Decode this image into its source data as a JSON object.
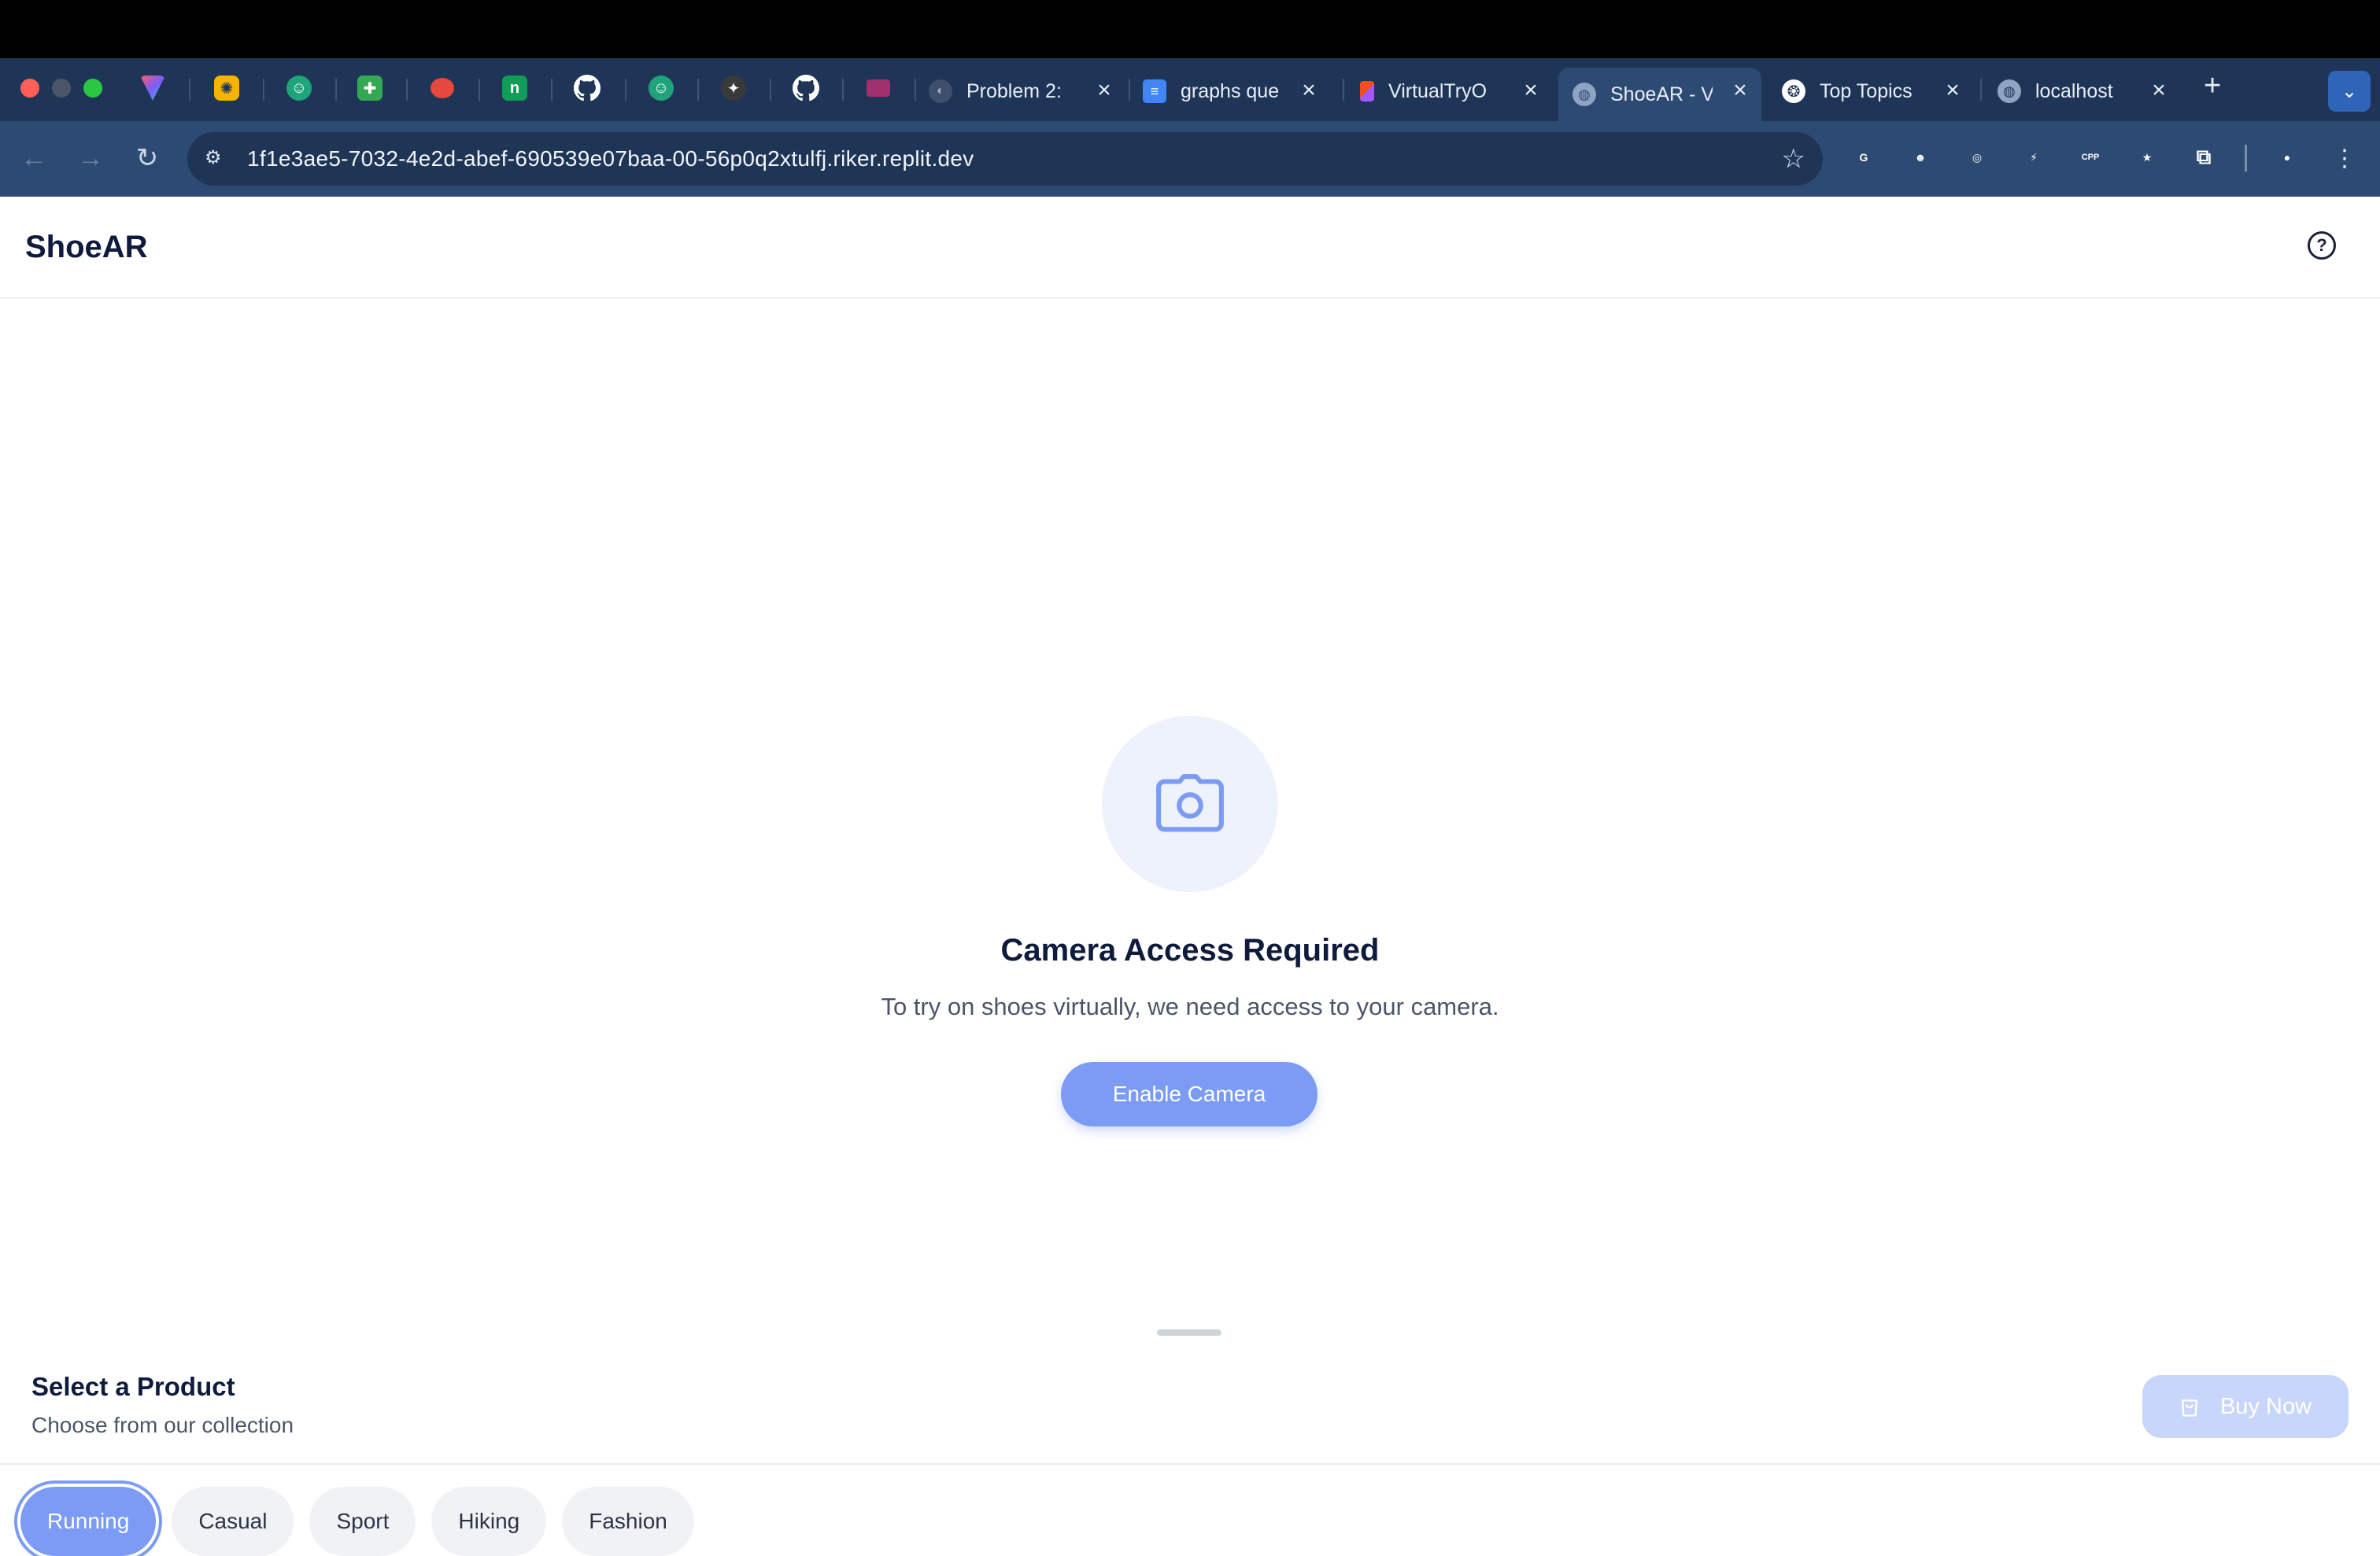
{
  "browser": {
    "pinned_tabs": [
      {
        "icon": "prism-icon",
        "color": "#7c5cff"
      },
      {
        "icon": "compass-icon",
        "color": "#f4b400"
      },
      {
        "icon": "chat-icon",
        "color": "#1fa37a"
      },
      {
        "icon": "plus-sheet-icon",
        "color": "#34a853"
      },
      {
        "icon": "tomato-icon",
        "color": "#e5483c"
      },
      {
        "icon": "n-icon",
        "color": "#0f9d58"
      },
      {
        "icon": "github-icon",
        "color": "#ffffff"
      },
      {
        "icon": "chat-icon",
        "color": "#1fa37a"
      },
      {
        "icon": "spark-icon",
        "color": "#3a3a3a"
      },
      {
        "icon": "github-icon",
        "color": "#ffffff"
      },
      {
        "icon": "slack-icon",
        "color": "#a0306e"
      }
    ],
    "tabs": [
      {
        "title": "Problem 2:",
        "icon": "mask-icon"
      },
      {
        "title": "graphs que",
        "icon": "doc-icon"
      },
      {
        "title": "VirtualTryO",
        "icon": "figma-icon"
      },
      {
        "title": "ShoeAR - V",
        "icon": "globe-icon",
        "active": true
      },
      {
        "title": "Top Topics",
        "icon": "openai-icon"
      },
      {
        "title": "localhost",
        "icon": "globe-icon"
      }
    ],
    "url": "1f1e3ae5-7032-4e2d-abef-690539e07baa-00-56p0q2xtulfj.riker.replit.dev",
    "extensions": [
      {
        "name": "grammarly-icon",
        "color": "#5a5a5a",
        "text": "G"
      },
      {
        "name": "robot-icon",
        "color": "#6fbf4a",
        "text": "☻"
      },
      {
        "name": "lens-icon",
        "color": "#f2c500",
        "text": "◎"
      },
      {
        "name": "bolt-icon",
        "color": "#9a9a9a",
        "text": "⚡"
      },
      {
        "name": "cpp-icon",
        "color": "#0b5a2a",
        "text": "CPP"
      },
      {
        "name": "flag-icon",
        "color": "#c8303b",
        "text": "★"
      },
      {
        "name": "puzzle-icon",
        "color": "#2d4a73",
        "text": "⧉"
      },
      {
        "name": "profile-icon",
        "color": "#1a8fa6",
        "text": "●"
      }
    ]
  },
  "app": {
    "brand": "ShoeAR",
    "help_symbol": "?"
  },
  "camera": {
    "title": "Camera Access Required",
    "description": "To try on shoes virtually, we need access to your camera.",
    "button": "Enable Camera"
  },
  "sheet": {
    "title": "Select a Product",
    "subtitle": "Choose from our collection",
    "buy_label": "Buy Now",
    "categories": [
      "Running",
      "Casual",
      "Sport",
      "Hiking",
      "Fashion"
    ],
    "selected_category": "Running"
  },
  "colors": {
    "accent": "#7b9bf4",
    "accent_light": "#eef2fc",
    "tab_bg": "#1f3557",
    "toolbar_bg": "#2d4a73"
  }
}
